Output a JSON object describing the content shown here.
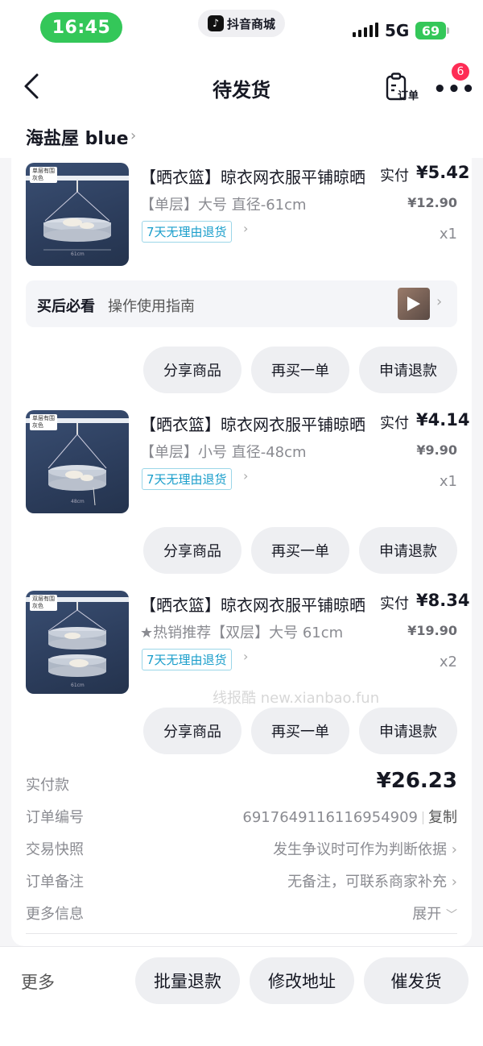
{
  "status_bar": {
    "time": "16:45",
    "app_name": "抖音商城",
    "network": "5G",
    "battery": "69"
  },
  "nav": {
    "title": "待发货",
    "order_icon_label": "订单",
    "badge_count": "6"
  },
  "shop": {
    "name": "海盐屋 blue"
  },
  "items": [
    {
      "title": "【晒衣篮】晾衣网衣服平铺晾晒",
      "spec": "【单层】大号 直径-61cm",
      "policy": "7天无理由退货",
      "pay_label": "实付",
      "pay_price": "¥5.42",
      "original_price": "¥12.90",
      "quantity": "x1",
      "thumb_tag_line1": "单层有围",
      "thumb_tag_line2": "灰色",
      "thumb_size": "61cm"
    },
    {
      "title": "【晒衣篮】晾衣网衣服平铺晾晒",
      "spec": "【单层】小号 直径-48cm",
      "policy": "7天无理由退货",
      "pay_label": "实付",
      "pay_price": "¥4.14",
      "original_price": "¥9.90",
      "quantity": "x1",
      "thumb_tag_line1": "单层有围",
      "thumb_tag_line2": "灰色",
      "thumb_size": "48cm"
    },
    {
      "title": "【晒衣篮】晾衣网衣服平铺晾晒",
      "spec": "★热销推荐【双层】大号 61cm",
      "policy": "7天无理由退货",
      "pay_label": "实付",
      "pay_price": "¥8.34",
      "original_price": "¥19.90",
      "quantity": "x2",
      "thumb_tag_line1": "双层有围",
      "thumb_tag_line2": "灰色",
      "thumb_size": "61cm"
    }
  ],
  "guide": {
    "label": "买后必看",
    "text": "操作使用指南"
  },
  "item_actions": {
    "share": "分享商品",
    "rebuy": "再买一单",
    "refund": "申请退款"
  },
  "order_info": {
    "total_label": "实付款",
    "total_value": "¥26.23",
    "order_no_label": "订单编号",
    "order_no": "6917649116116954909",
    "copy": "复制",
    "snapshot_label": "交易快照",
    "snapshot_value": "发生争议时可作为判断依据",
    "remark_label": "订单备注",
    "remark_value": "无备注，可联系商家补充",
    "more_info_label": "更多信息",
    "expand": "展开"
  },
  "watermark": "线报酷 new.xianbao.fun",
  "bottom_bar": {
    "more": "更多",
    "batch_refund": "批量退款",
    "change_address": "修改地址",
    "urge_shipping": "催发货"
  },
  "colors": {
    "status_green": "#34c759",
    "badge_red": "#fe2c55",
    "policy_blue": "#1a9ecb"
  }
}
